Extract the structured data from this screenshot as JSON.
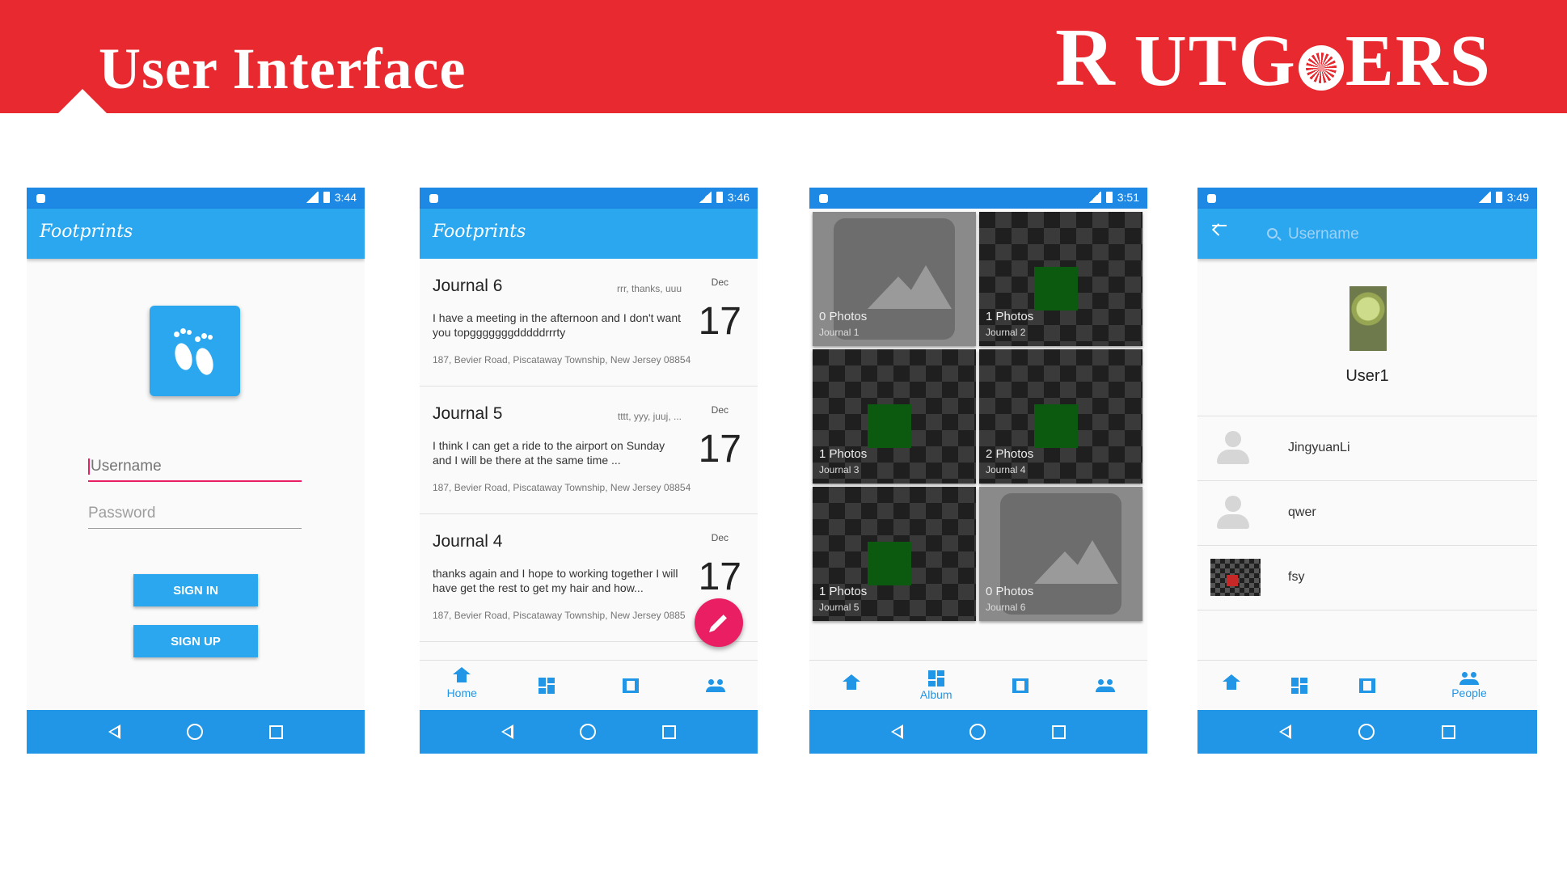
{
  "slide": {
    "title": "User Interface",
    "brand": {
      "first": "R",
      "rest_a": "UTG",
      "rest_b": "ERS"
    },
    "colors": {
      "header_red": "#e8292f",
      "app_blue": "#2aa7ee",
      "accent_pink": "#e91e63"
    }
  },
  "login": {
    "status_time": "3:44",
    "app_title": "Footprints",
    "logo_icon": "footprints-icon",
    "username_placeholder": "Username",
    "password_placeholder": "Password",
    "signin_label": "SIGN IN",
    "signup_label": "SIGN UP"
  },
  "home": {
    "status_time": "3:46",
    "app_title": "Footprints",
    "journals": [
      {
        "title": "Journal 6",
        "tags": "rrr,  thanks,  uuu",
        "body": "I have a meeting in the afternoon and I don't want you topgggggggdddddrrrty",
        "address": "187, Bevier Road, Piscataway Township, New Jersey 08854",
        "month": "Dec",
        "day": "17"
      },
      {
        "title": "Journal 5",
        "tags": "tttt,  yyy,  juuj,  ...",
        "body": "I think I can get a ride to the airport on Sunday and I will be there at the same time ...",
        "address": "187, Bevier Road, Piscataway Township, New Jersey 08854",
        "month": "Dec",
        "day": "17"
      },
      {
        "title": "Journal 4",
        "tags": "",
        "body": "thanks again and I hope to working together I will have get the rest to get my hair and how...",
        "address": "187, Bevier Road, Piscataway Township, New Jersey 0885",
        "month": "Dec",
        "day": "17"
      }
    ],
    "fab_icon": "pencil-icon",
    "tabs": [
      {
        "icon": "home-icon",
        "label": "Home"
      },
      {
        "icon": "album-icon",
        "label": ""
      },
      {
        "icon": "map-icon",
        "label": ""
      },
      {
        "icon": "people-icon",
        "label": ""
      }
    ]
  },
  "album": {
    "status_time": "3:51",
    "cells": [
      {
        "count": "0 Photos",
        "name": "Journal 1",
        "kind": "placeholder"
      },
      {
        "count": "1 Photos",
        "name": "Journal 2",
        "kind": "photo"
      },
      {
        "count": "1 Photos",
        "name": "Journal 3",
        "kind": "photo"
      },
      {
        "count": "2 Photos",
        "name": "Journal 4",
        "kind": "photo"
      },
      {
        "count": "1 Photos",
        "name": "Journal 5",
        "kind": "photo"
      },
      {
        "count": "0 Photos",
        "name": "Journal 6",
        "kind": "placeholder"
      }
    ],
    "tabs": [
      {
        "icon": "home-icon",
        "label": ""
      },
      {
        "icon": "album-icon",
        "label": "Album"
      },
      {
        "icon": "map-icon",
        "label": ""
      },
      {
        "icon": "people-icon",
        "label": ""
      }
    ]
  },
  "people": {
    "status_time": "3:49",
    "search_placeholder": "Username",
    "profile_name": "User1",
    "users": [
      {
        "name": "JingyuanLi",
        "avatar": "default"
      },
      {
        "name": "qwer",
        "avatar": "default"
      },
      {
        "name": "fsy",
        "avatar": "image"
      }
    ],
    "tabs": [
      {
        "icon": "home-icon",
        "label": ""
      },
      {
        "icon": "album-icon",
        "label": ""
      },
      {
        "icon": "map-icon",
        "label": ""
      },
      {
        "icon": "people-icon",
        "label": "People"
      }
    ]
  }
}
